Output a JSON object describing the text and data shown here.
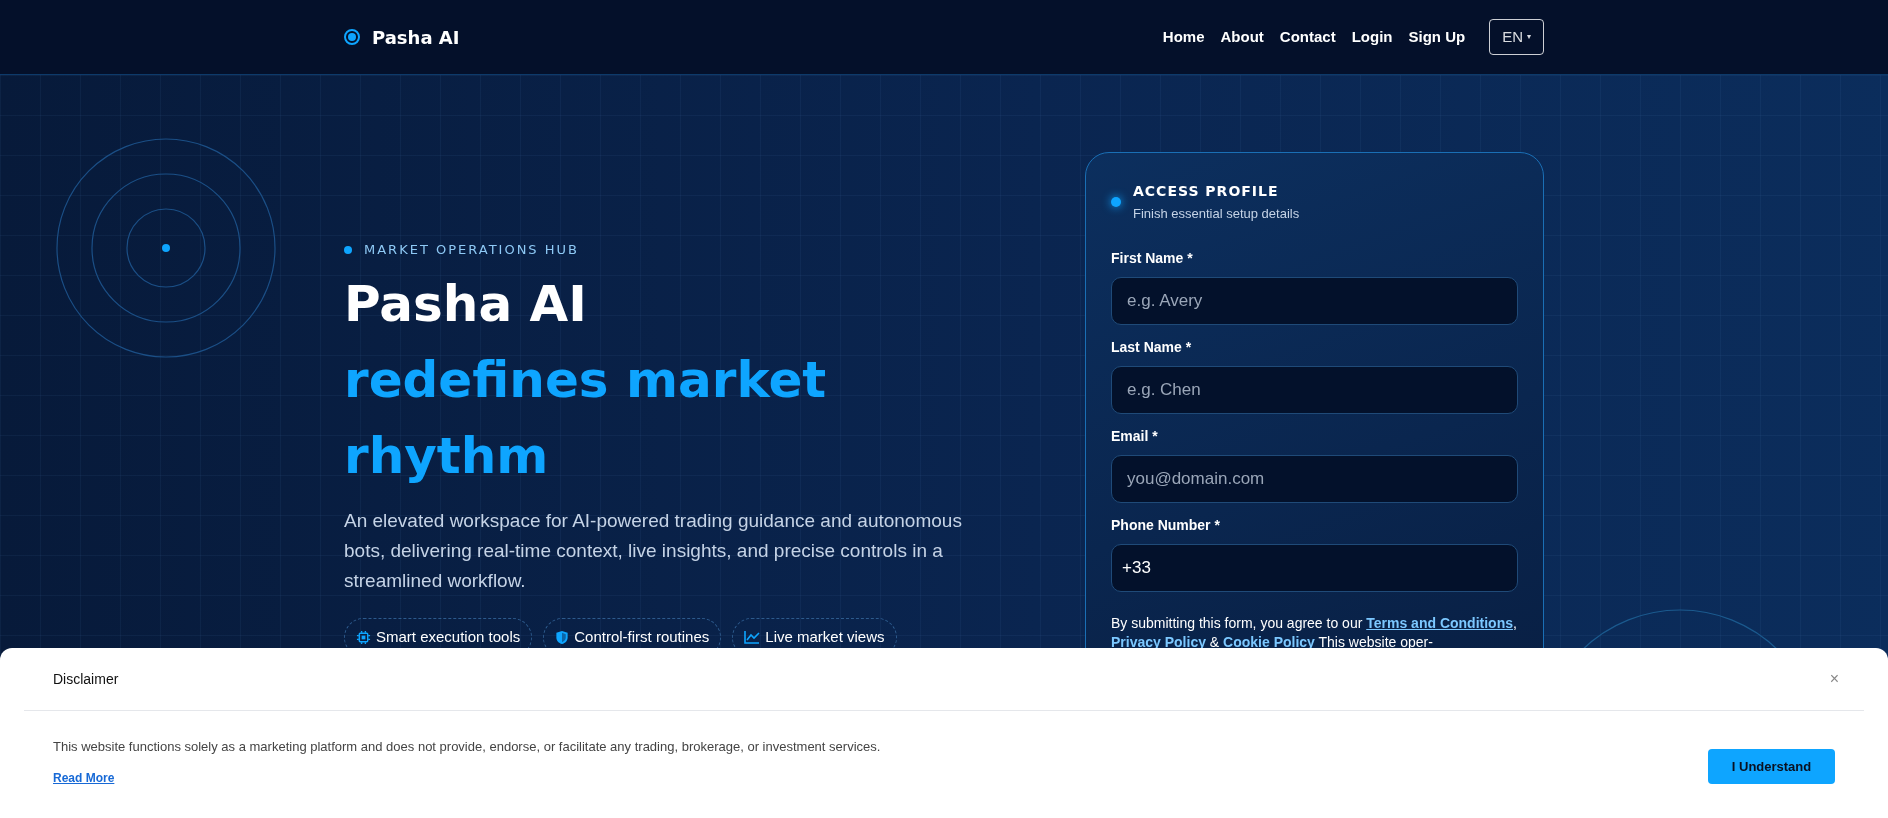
{
  "header": {
    "logo": "Pasha AI",
    "nav": [
      "Home",
      "About",
      "Contact",
      "Login",
      "Sign Up"
    ],
    "language": "EN",
    "language_caret": "▾"
  },
  "hero": {
    "eyebrow": "MARKET OPERATIONS HUB",
    "title_line": "Pasha AI",
    "title_accent": "redefines market rhythm",
    "description": "An elevated workspace for AI-powered trading guidance and autonomous bots, delivering real-time context, live insights, and precise controls in a streamlined workflow.",
    "features": [
      {
        "kind": "chip",
        "label": "Smart execution tools"
      },
      {
        "kind": "shield",
        "label": "Control-first routines"
      },
      {
        "kind": "chart",
        "label": "Live market views"
      }
    ]
  },
  "form": {
    "title": "ACCESS PROFILE",
    "subtitle": "Finish essential setup details",
    "fields": [
      {
        "label": "First Name *",
        "placeholder": "e.g. Avery"
      },
      {
        "label": "Last Name *",
        "placeholder": "e.g. Chen"
      },
      {
        "label": "Email *",
        "placeholder": "you@domain.com"
      },
      {
        "label": "Phone Number *",
        "value": "+33"
      }
    ],
    "consent": [
      {
        "kind": "text",
        "text": "By submitting this form, you agree to our "
      },
      {
        "kind": "link",
        "text": "Terms and Conditions"
      },
      {
        "kind": "text",
        "text": ", "
      },
      {
        "kind": "link",
        "text": "Privacy Policy"
      },
      {
        "kind": "text",
        "text": " & "
      },
      {
        "kind": "link",
        "text": "Cookie Policy"
      },
      {
        "kind": "text",
        "text": " This website oper-"
      }
    ]
  },
  "disclaimer": {
    "title": "Disclaimer",
    "close": "×",
    "text": "This website functions solely as a marketing platform and does not provide, endorse, or facilitate any trading, brokerage, or investment services.",
    "link": "Read More",
    "button": "I Understand"
  }
}
